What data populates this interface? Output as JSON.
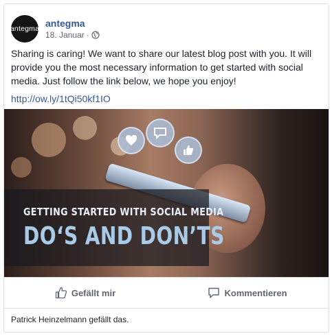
{
  "post": {
    "author": "antegma",
    "avatar_text": "antegma",
    "date": "18. Januar",
    "separator": "·",
    "privacy_icon": "globe-icon",
    "text": "Sharing is caring! We want to share our latest blog post with you. It will provide you the most necessary information to get started with social media. Just follow the link below, we hope you enjoy!",
    "link": "http://ow.ly/1tQi50kf1IO"
  },
  "image": {
    "line1": "GETTING STARTED WITH SOCIAL MEDIA",
    "line2": "DO‘S AND DON’TS",
    "bubbles": [
      "heart-icon",
      "chat-icon",
      "thumbs-up-icon"
    ]
  },
  "actions": {
    "like_label": "Gefällt mir",
    "like_icon": "thumbs-up-icon",
    "comment_label": "Kommentieren",
    "comment_icon": "comment-icon"
  },
  "reactions": {
    "text": "Patrick Heinzelmann gefällt das."
  },
  "colors": {
    "link": "#365899",
    "text": "#1d2129",
    "muted": "#616770",
    "border": "#dddfe2"
  }
}
